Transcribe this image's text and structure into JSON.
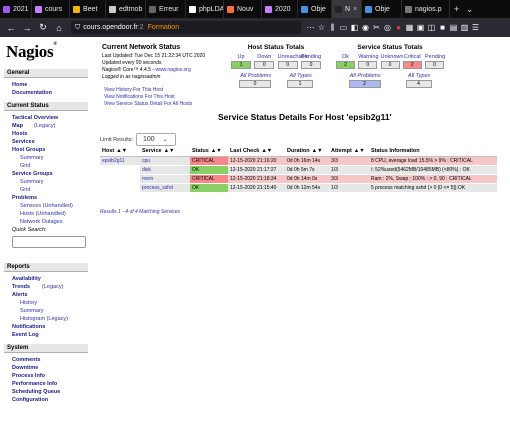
{
  "browser": {
    "tabs": [
      {
        "label": "2021",
        "color": "#9a5cf0"
      },
      {
        "label": "cours",
        "color": "#c77dff"
      },
      {
        "label": "Beet",
        "color": "#f4b400"
      },
      {
        "label": "edtmob",
        "color": "#cccccc"
      },
      {
        "label": "Erreur",
        "color": "#666666"
      },
      {
        "label": "phpLDA",
        "color": "#ffffff"
      },
      {
        "label": "Nouv",
        "color": "#ff7139"
      },
      {
        "label": "2020",
        "color": "#c77dff"
      },
      {
        "label": "Obje",
        "color": "#4a90e2"
      },
      {
        "label": "N",
        "color": "#222222"
      },
      {
        "label": "Obje",
        "color": "#4a90e2"
      },
      {
        "label": "nagios.p",
        "color": "#777777"
      }
    ],
    "url_main": "cours.opendoor.fr",
    "url_rest": ":2",
    "url_tag": "Formation",
    "new_tab": "+",
    "menu_caret": "⌄"
  },
  "sidebar": {
    "logo": "Nagios",
    "general_header": "General",
    "home": "Home",
    "documentation": "Documentation",
    "current_status_header": "Current Status",
    "tactical_overview": "Tactical Overview",
    "map": "Map",
    "legacy": "(Legacy)",
    "hosts": "Hosts",
    "services": "Services",
    "host_groups": "Host Groups",
    "summary": "Summary",
    "grid": "Grid",
    "service_groups": "Service Groups",
    "problems": "Problems",
    "services_unhandled": "Services (Unhandled)",
    "hosts_unhandled": "Hosts (Unhandled)",
    "network_outages": "Network Outages",
    "quick_search": "Quick Search:",
    "reports_header": "Reports",
    "availability": "Availability",
    "trends": "Trends",
    "alerts": "Alerts",
    "history": "History",
    "histogram": "Histogram (Legacy)",
    "system_header": "System",
    "comments": "Comments",
    "downtime": "Downtime",
    "process_info": "Process Info",
    "performance_info": "Performance Info",
    "scheduling_queue": "Scheduling Queue",
    "configuration": "Configuration"
  },
  "status_header": {
    "title": "Current Network Status",
    "last_updated": "Last Updated: Tue Dec 15 21:22:34 UTC 2020",
    "update_interval": "Updated every 90 seconds",
    "version_prefix": "Nagios® Core™ 4.4.5 - ",
    "version_link": "www.nagios.org",
    "logged_in": "Logged in as nagiosadmin",
    "link_history": "View History For This Host",
    "link_notifications": "View Notifications For This Host",
    "link_detail_all": "View Service Status Detail For All Hosts"
  },
  "host_totals": {
    "title": "Host Status Totals",
    "headers": [
      "Up",
      "Down",
      "Unreachable",
      "Pending"
    ],
    "values": [
      "1",
      "0",
      "0",
      "0"
    ],
    "all_problems_label": "All Problems",
    "all_types_label": "All Types",
    "all_problems": "0",
    "all_types": "1"
  },
  "service_totals": {
    "title": "Service Status Totals",
    "headers": [
      "Ok",
      "Warning",
      "Unknown",
      "Critical",
      "Pending"
    ],
    "values": [
      "2",
      "0",
      "0",
      "2",
      "0"
    ],
    "all_problems_label": "All Problems",
    "all_types_label": "All Types",
    "all_problems": "2",
    "all_types": "4"
  },
  "page_title": "Service Status Details For Host 'epsib2g11'",
  "limit": {
    "label": "Limit Results:",
    "value": "100",
    "caret": "⌄"
  },
  "table": {
    "headers": [
      "Host",
      "Service",
      "Status",
      "Last Check",
      "Duration",
      "Attempt",
      "Status Information"
    ],
    "sort_arrows": "▲▼",
    "rows": [
      {
        "host": "epsib2g11",
        "service": "cpu",
        "status": "CRITICAL",
        "last_check": "12-15-2020 21:16:20",
        "duration": "0d 0h 16m 14s",
        "attempt": "3/3",
        "info": "8 CPU, average load 15.5% > 9% : CRITICAL"
      },
      {
        "host": "",
        "service": "disk",
        "status": "OK",
        "last_check": "12-15-2020 21:17:27",
        "duration": "0d 0h 5m 7s",
        "attempt": "1/3",
        "info": "/: 52%used(5462MB/10485MB) (<80%) : OK"
      },
      {
        "host": "",
        "service": "mem",
        "status": "CRITICAL",
        "last_check": "12-15-2020 21:18:34",
        "duration": "0d 0h 14m 0s",
        "attempt": "3/3",
        "info": "Ram : 2%, Swap : 100% : > 0, 90 : CRITICAL"
      },
      {
        "host": "",
        "service": "process_sshd",
        "status": "OK",
        "last_check": "12-15-2020 21:15:40",
        "duration": "0d 0h 12m 54s",
        "attempt": "1/3",
        "info": "5 process matching sshd (> 0 [0 <= 5]):OK"
      }
    ],
    "results": "Results 1 - 4 of 4 Matching Services"
  }
}
